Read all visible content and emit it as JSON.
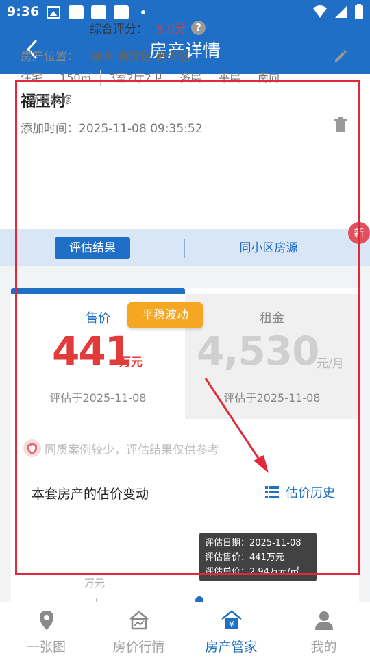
{
  "statusbar": {
    "time": "9:36"
  },
  "navbar": {
    "title": "房产详情"
  },
  "property": {
    "name": "福玉村",
    "score_label": "综合评分：",
    "score_value": "8.0分",
    "location_label": "房产位置：",
    "location_value": "福州 晋安区 晋安区",
    "tags": [
      "住宅",
      "150㎡",
      "3室2厅2卫",
      "多层",
      "平层",
      "南向",
      "简单装修"
    ],
    "added_label": "添加时间：",
    "added_value": "2025-11-08 09:35:52"
  },
  "tabs": {
    "active": "评估结果",
    "other": "同小区房源",
    "badge": "新"
  },
  "valuation": {
    "sale_label": "售价",
    "sale_value": "441",
    "sale_unit": "万元",
    "sale_date": "评估于2025-11-08",
    "stability_badge": "平稳波动",
    "rent_label": "租金",
    "rent_value": "4,530",
    "rent_unit": "元/月",
    "rent_date": "评估于2025-11-08"
  },
  "notice": "同质案例较少，评估结果仅供参考",
  "history": {
    "title": "本套房产的估价变动",
    "link": "估价历史",
    "y_unit": "万元",
    "tooltip": {
      "date_line": "评估日期：2025-11-08",
      "price_line": "评估售价：441万元",
      "unit_line": "评估单价：2.94万元/㎡"
    }
  },
  "bottom_nav": [
    {
      "label": "一张图",
      "icon": "location-pin-icon"
    },
    {
      "label": "房价行情",
      "icon": "house-chart-icon"
    },
    {
      "label": "房产管家",
      "icon": "house-yuan-icon",
      "active": true
    },
    {
      "label": "我的",
      "icon": "person-icon"
    }
  ],
  "colors": {
    "primary": "#1f6fc6",
    "price_red": "#e23b3b",
    "badge_orange": "#f5a623",
    "annotation_red": "#e02a3b"
  }
}
